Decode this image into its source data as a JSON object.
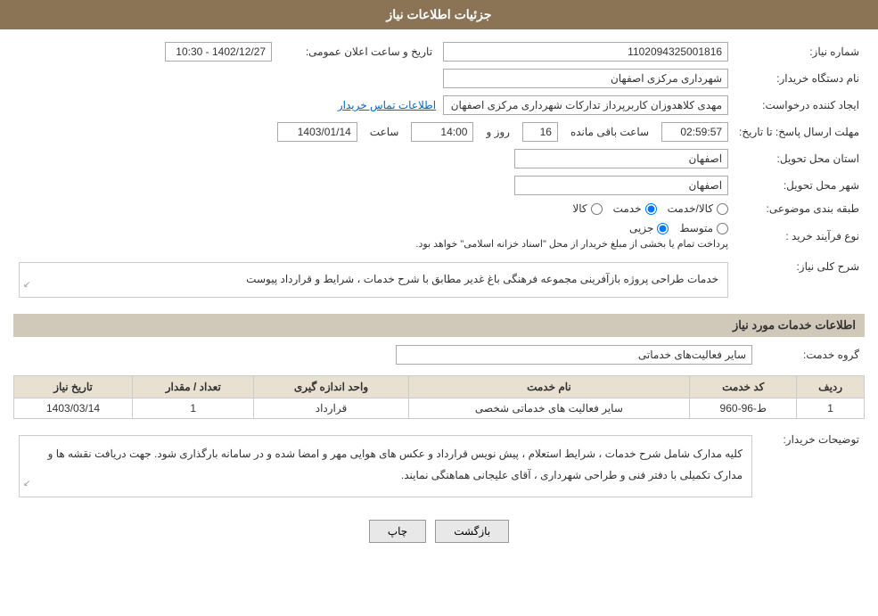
{
  "header": {
    "title": "جزئیات اطلاعات نیاز"
  },
  "fields": {
    "need_number_label": "شماره نیاز:",
    "need_number_value": "1102094325001816",
    "buyer_org_label": "نام دستگاه خریدار:",
    "buyer_org_value": "شهرداری مرکزی اصفهان",
    "creator_label": "ایجاد کننده درخواست:",
    "creator_value": "مهدی کلاهدوزان کاربرپرداز تداركات شهرداری مرکزی اصفهان",
    "contact_link": "اطلاعات تماس خریدار",
    "deadline_label": "مهلت ارسال پاسخ: تا تاریخ:",
    "deadline_date": "1403/01/14",
    "deadline_time_label": "ساعت",
    "deadline_time": "14:00",
    "deadline_day_label": "روز و",
    "deadline_days": "16",
    "deadline_remaining_label": "ساعت باقی مانده",
    "deadline_remaining": "02:59:57",
    "announce_label": "تاریخ و ساعت اعلان عمومی:",
    "announce_value": "1402/12/27 - 10:30",
    "province_label": "استان محل تحویل:",
    "province_value": "اصفهان",
    "city_label": "شهر محل تحویل:",
    "city_value": "اصفهان",
    "category_label": "طبقه بندی موضوعی:",
    "category_goods": "کالا",
    "category_service": "خدمت",
    "category_goods_service": "کالا/خدمت",
    "category_selected": "خدمت",
    "purchase_type_label": "نوع فرآیند خرید :",
    "purchase_partial": "جزیی",
    "purchase_medium": "متوسط",
    "purchase_note": "پرداخت تمام یا بخشی از مبلغ خریدار از محل \"اسناد خزانه اسلامی\" خواهد بود.",
    "need_description_label": "شرح کلی نیاز:",
    "need_description_value": "خدمات طراحی پروژه بازآفرینی مجموعه فرهنگی باغ غدیر مطابق با شرح خدمات ، شرایط و قرارداد پیوست"
  },
  "service_info": {
    "section_title": "اطلاعات خدمات مورد نیاز",
    "group_label": "گروه خدمت:",
    "group_value": "سایر فعالیت‌های خدماتی",
    "table": {
      "headers": [
        "ردیف",
        "کد خدمت",
        "نام خدمت",
        "واحد اندازه گیری",
        "تعداد / مقدار",
        "تاریخ نیاز"
      ],
      "rows": [
        {
          "row": "1",
          "code": "ط-96-960",
          "name": "سایر فعالیت های خدماتی شخصی",
          "unit": "قرارداد",
          "quantity": "1",
          "date": "1403/03/14"
        }
      ]
    }
  },
  "buyer_notes": {
    "label": "توضیحات خریدار:",
    "text": "کلیه مدارک شامل شرح خدمات ، شرایط استعلام ، پیش نویس قرارداد و عکس های هوایی مهر و امضا شده و در سامانه بارگذاری شود.\nجهت دریافت نقشه ها و مدارک تکمیلی با دفتر فنی و طراحی شهرداری ، آقای علیجانی هماهنگی نمایند."
  },
  "buttons": {
    "print": "چاپ",
    "back": "بازگشت"
  }
}
